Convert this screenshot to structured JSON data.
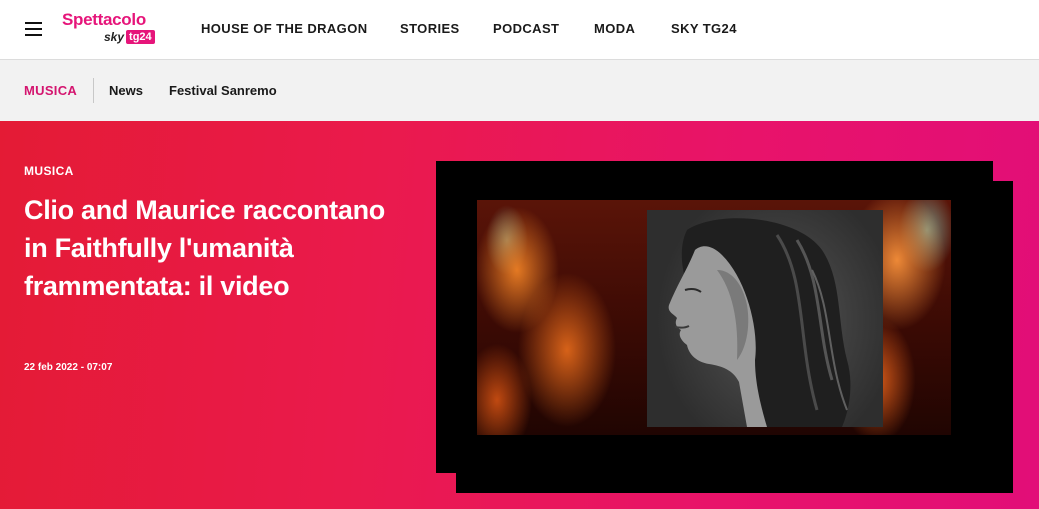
{
  "header": {
    "logo": {
      "word": "Spettacolo",
      "sky": "sky",
      "tg": "tg24"
    },
    "nav": [
      "HOUSE OF THE DRAGON",
      "STORIES",
      "PODCAST",
      "MODA",
      "SKY TG24"
    ]
  },
  "subnav": {
    "active": "MUSICA",
    "links": [
      "News",
      "Festival Sanremo"
    ]
  },
  "hero": {
    "category": "MUSICA",
    "title": "Clio and Maurice raccontano in Faithfully l'umanità frammentata: il video",
    "date": "22 feb 2022 - 07:07"
  },
  "colors": {
    "brand": "#e6157a",
    "hero_start": "#e41b35",
    "hero_end": "#e20e78"
  }
}
